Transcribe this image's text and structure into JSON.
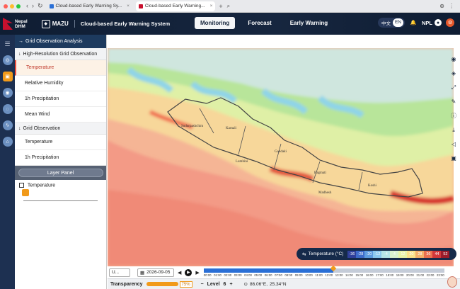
{
  "browser": {
    "tabs": [
      {
        "title": "Cloud-based Early Warning Sy..."
      },
      {
        "title": "Cloud-based Early Warning..."
      }
    ]
  },
  "header": {
    "org_line1": "Nepal",
    "org_line2": "DHM",
    "brand": "MAZU",
    "app_title": "Cloud-based Early Warning System",
    "nav": [
      "Monitoring",
      "Forecast",
      "Early Warning"
    ],
    "active_nav": "Monitoring",
    "lang_options": [
      "中文",
      "EN"
    ],
    "active_lang": "EN",
    "user": "NPL"
  },
  "panel": {
    "title": "Grid Observation Analysis",
    "sections": [
      {
        "label": "High-Resolution Grid Observation",
        "items": [
          "Temperature",
          "Relative Humidity",
          "1h Precipitation",
          "Mean Wind"
        ]
      },
      {
        "label": "Grid Observation",
        "items": [
          "Temperature",
          "1h Precipitation"
        ]
      }
    ],
    "selected_item": "Temperature",
    "layer_panel_label": "Layer Panel",
    "layer_entry": "Temperature"
  },
  "map": {
    "place_labels": [
      "Sudurpashchim",
      "Karnali",
      "Lumbini",
      "Gandaki",
      "Bagmati",
      "Madhesh",
      "Koshi"
    ]
  },
  "legend": {
    "title": "Temperature (°C)",
    "values": [
      "-36",
      "-28",
      "-20",
      "-12",
      "-4",
      "4",
      "12",
      "20",
      "28",
      "36",
      "44",
      "52"
    ],
    "colors": [
      "#2f3f9a",
      "#3d6ac9",
      "#5e9ce0",
      "#8cc9ef",
      "#b6e6e8",
      "#d9f2cf",
      "#e9f5a8",
      "#fbe28a",
      "#f5b06a",
      "#ea6f4e",
      "#d1373a",
      "#9b1c2a"
    ]
  },
  "timebar": {
    "select_value": "U...",
    "date": "2026-09-05",
    "hours": [
      "00:00",
      "01:00",
      "02:00",
      "03:00",
      "04:00",
      "05:00",
      "06:00",
      "07:00",
      "08:00",
      "09:00",
      "10:00",
      "11:00",
      "12:00",
      "13:00",
      "14:00",
      "15:00",
      "16:00",
      "17:00",
      "18:00",
      "19:00",
      "20:00",
      "21:00",
      "22:00",
      "23:00"
    ],
    "progress": 0.54
  },
  "bottombar": {
    "transparency_label": "Transparency",
    "transparency_value": "75%",
    "level_label": "Level",
    "level_value": "6",
    "lon": "86.06°E,",
    "lat": "25.34°N"
  }
}
